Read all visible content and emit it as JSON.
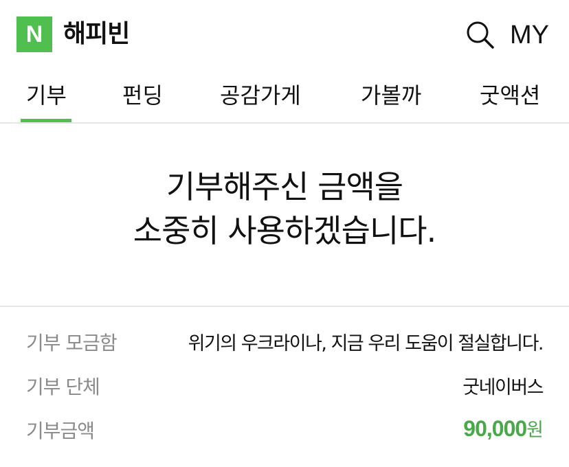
{
  "header": {
    "logo_letter": "N",
    "brand": "해피빈",
    "my_label": "MY",
    "search_icon": "search-icon",
    "logo_color": "#4fbf4f"
  },
  "tabs": [
    {
      "label": "기부",
      "active": true
    },
    {
      "label": "펀딩",
      "active": false
    },
    {
      "label": "공감가게",
      "active": false
    },
    {
      "label": "가볼까",
      "active": false
    },
    {
      "label": "굿액션",
      "active": false
    }
  ],
  "accent_color": "#4fbf4f",
  "message": {
    "line1": "기부해주신 금액을",
    "line2": "소중히 사용하겠습니다."
  },
  "info": {
    "fundraiser_label": "기부 모금함",
    "fundraiser_value": "위기의 우크라이나, 지금 우리 도움이 절실합니다.",
    "org_label": "기부 단체",
    "org_value": "굿네이버스",
    "amount_label": "기부금액",
    "amount_value": "90,000",
    "amount_unit": "원",
    "amount_color": "#4aa84a"
  }
}
